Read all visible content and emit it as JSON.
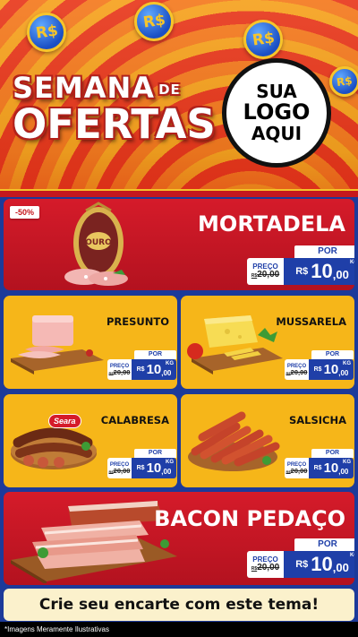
{
  "header": {
    "title_line1": "SEMANA",
    "title_de": "DE",
    "title_line2": "OFERTAS",
    "coin_label": "R$",
    "logo": {
      "line1": "SUA",
      "line2": "LOGO",
      "line3": "AQUI"
    }
  },
  "products": [
    {
      "name": "MORTADELA",
      "badge": "-50%",
      "por": "POR",
      "preco": "PREÇO",
      "old": "20,00",
      "old_prefix": "R$",
      "currency": "R$",
      "price_int": "10",
      "price_dec": ",00",
      "unit": "KG"
    },
    {
      "name": "PRESUNTO",
      "por": "POR",
      "preco": "PREÇO",
      "old": "20,00",
      "old_prefix": "R$",
      "currency": "R$",
      "price_int": "10",
      "price_dec": ",00",
      "unit": "KG"
    },
    {
      "name": "MUSSARELA",
      "por": "POR",
      "preco": "PREÇO",
      "old": "20,00",
      "old_prefix": "R$",
      "currency": "R$",
      "price_int": "10",
      "price_dec": ",00",
      "unit": "KG"
    },
    {
      "name": "CALABRESA",
      "brand": "Seara",
      "por": "POR",
      "preco": "PREÇO",
      "old": "20,00",
      "old_prefix": "R$",
      "currency": "R$",
      "price_int": "10",
      "price_dec": ",00",
      "unit": "KG"
    },
    {
      "name": "SALSICHA",
      "por": "POR",
      "preco": "PREÇO",
      "old": "20,00",
      "old_prefix": "R$",
      "currency": "R$",
      "price_int": "10",
      "price_dec": ",00",
      "unit": "KG"
    },
    {
      "name": "BACON PEDAÇO",
      "por": "POR",
      "preco": "PREÇO",
      "old": "20,00",
      "old_prefix": "R$",
      "currency": "R$",
      "price_int": "10",
      "price_dec": ",00",
      "unit": "KG"
    }
  ],
  "mortadela_brand": "OURO",
  "cta": "Crie seu encarte com este tema!",
  "disclaimer": "*Imagens Meramente Ilustrativas",
  "colors": {
    "blue": "#1f3fa8",
    "red": "#c5181d",
    "yellow": "#f6b619",
    "orange": "#ee5a1d"
  }
}
